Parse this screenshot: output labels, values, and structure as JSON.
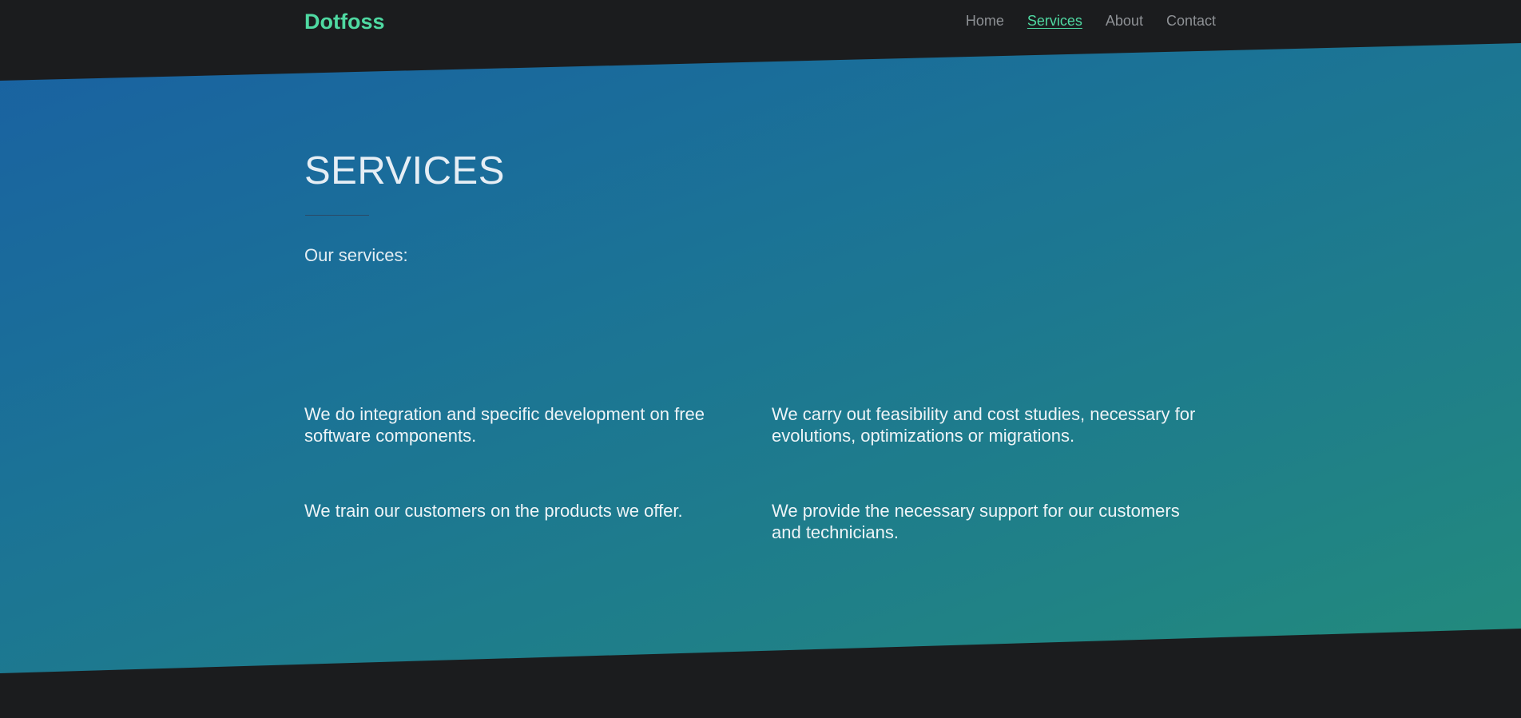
{
  "brand": {
    "name": "Dotfoss",
    "accent_color": "#4fd9a2"
  },
  "nav": {
    "items": [
      {
        "label": "Home",
        "active": false
      },
      {
        "label": "Services",
        "active": true
      },
      {
        "label": "About",
        "active": false
      },
      {
        "label": "Contact",
        "active": false
      }
    ]
  },
  "main": {
    "title": "SERVICES",
    "intro": "Our services:",
    "services": [
      "We do integration and specific development on free software components.",
      "We carry out feasibility and cost studies, necessary for evolutions, optimizations or migrations.",
      "We train our customers on the products we offer.",
      "We provide the necessary support for our customers and technicians."
    ]
  },
  "colors": {
    "background": "#1b1c1e",
    "gradient_start": "#1960a3",
    "gradient_end": "#238d7a",
    "nav_text": "#8e9195"
  }
}
